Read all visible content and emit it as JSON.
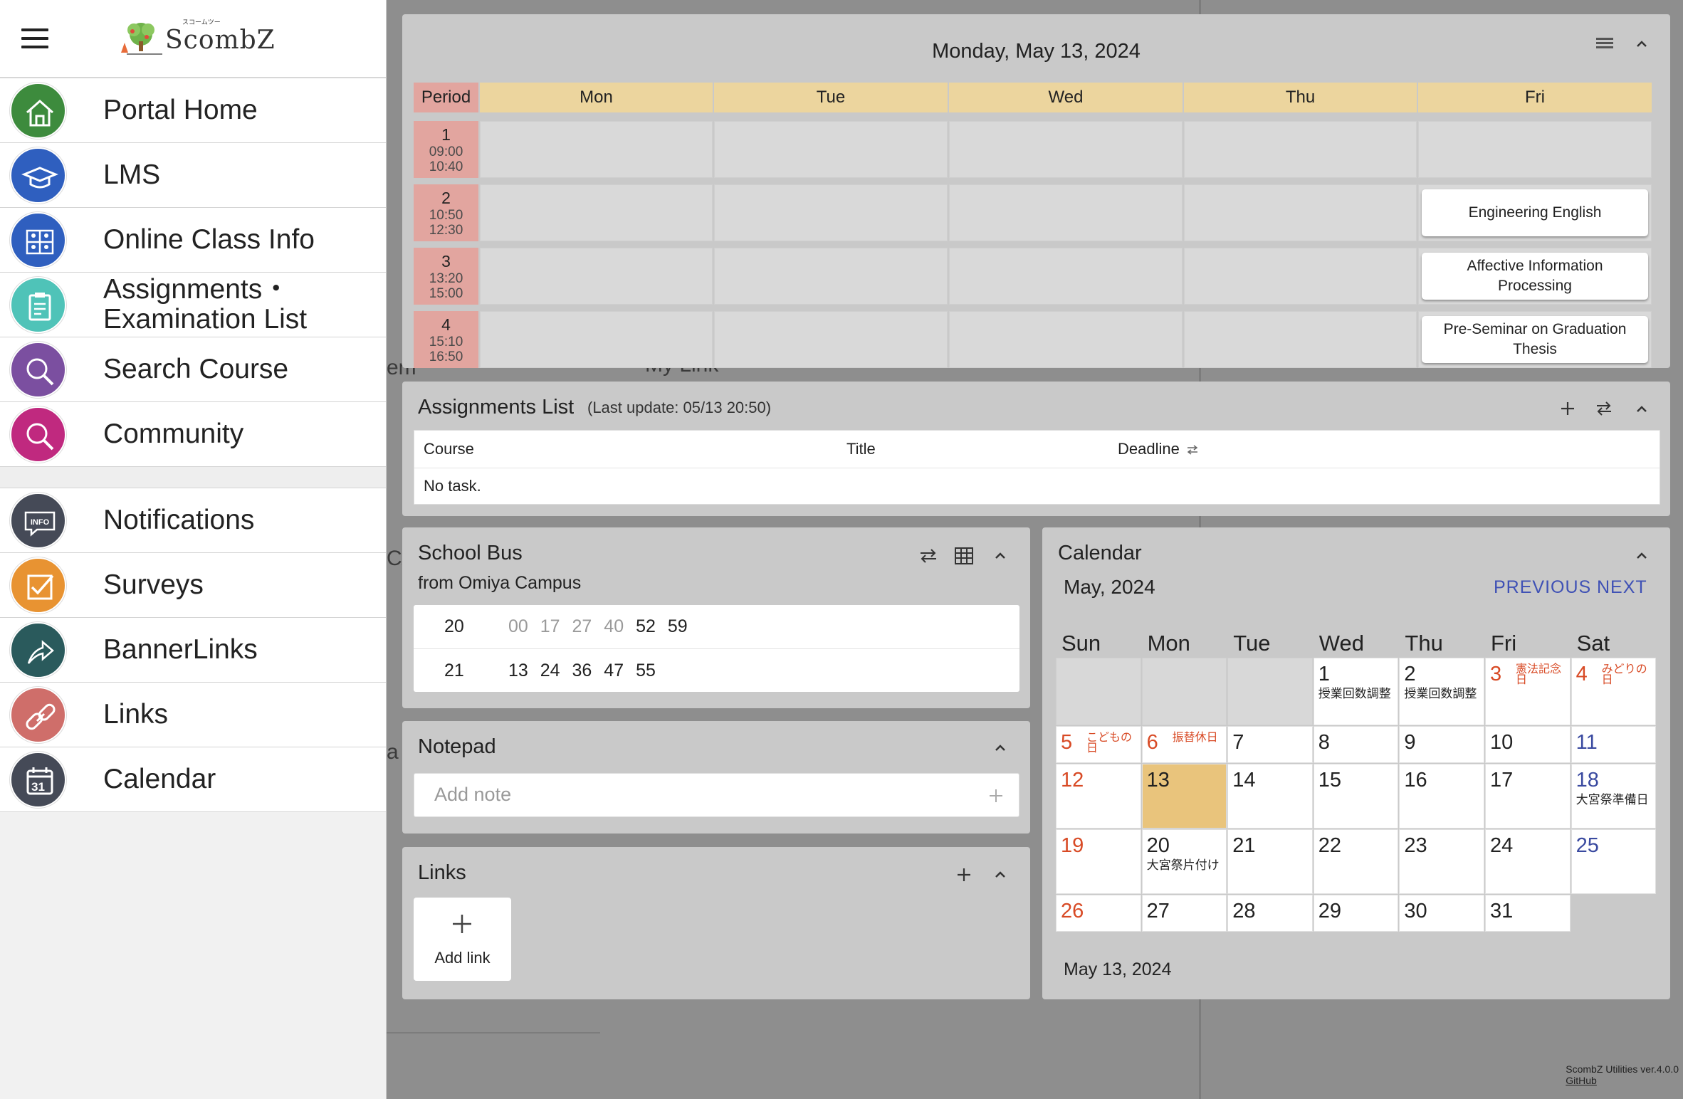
{
  "sidebar": {
    "logo_caption": "スコームツー",
    "logo_text": "ScombZ",
    "items_top": [
      {
        "label": "Portal Home",
        "icon": "house-icon",
        "color": "#3d8b3d"
      },
      {
        "label": "LMS",
        "icon": "graduation-cap-icon",
        "color": "#2f5fbf"
      },
      {
        "label": "Online Class Info",
        "icon": "online-class-icon",
        "color": "#2f5fbf"
      },
      {
        "label": "Assignments・\nExamination List",
        "icon": "clipboard-icon",
        "color": "#4fc3b8"
      },
      {
        "label": "Search Course",
        "icon": "search-icon",
        "color": "#7b4fa0"
      },
      {
        "label": "Community",
        "icon": "search-icon",
        "color": "#c0297f"
      }
    ],
    "items_bottom": [
      {
        "label": "Notifications",
        "icon": "info-bubble-icon",
        "color": "#454a57"
      },
      {
        "label": "Surveys",
        "icon": "checkbox-icon",
        "color": "#e89332"
      },
      {
        "label": "BannerLinks",
        "icon": "arrow-up-icon",
        "color": "#2a5a5c"
      },
      {
        "label": "Links",
        "icon": "link-icon",
        "color": "#cf6e6a"
      },
      {
        "label": "Calendar",
        "icon": "calendar-icon",
        "color": "#454a57",
        "icon_text": "31"
      }
    ]
  },
  "backdrop": {
    "frag_em": "em",
    "frag_mylink": "My Link",
    "frag_ca": "CA",
    "frag_a": "a"
  },
  "timetable": {
    "date": "Monday, May 13, 2024",
    "period_label": "Period",
    "days": [
      "Mon",
      "Tue",
      "Wed",
      "Thu",
      "Fri"
    ],
    "periods": [
      {
        "num": "1",
        "start": "09:00",
        "end": "10:40"
      },
      {
        "num": "2",
        "start": "10:50",
        "end": "12:30"
      },
      {
        "num": "3",
        "start": "13:20",
        "end": "15:00"
      },
      {
        "num": "4",
        "start": "15:10",
        "end": "16:50"
      }
    ],
    "courses": [
      {
        "period": 2,
        "day": 5,
        "name": "Engineering English"
      },
      {
        "period": 3,
        "day": 5,
        "name": "Affective Information Processing"
      },
      {
        "period": 4,
        "day": 5,
        "name": "Pre-Seminar on Graduation Thesis"
      }
    ]
  },
  "assignments": {
    "title": "Assignments List",
    "last_update": "(Last update: 05/13 20:50)",
    "col_course": "Course",
    "col_title": "Title",
    "col_deadline": "Deadline",
    "empty": "No task."
  },
  "bus": {
    "title": "School Bus",
    "subtitle": "from Omiya Campus",
    "rows": [
      {
        "hour": "20",
        "past": [
          "00",
          "17",
          "27",
          "40"
        ],
        "upcoming": [
          "52",
          "59"
        ]
      },
      {
        "hour": "21",
        "past": [],
        "upcoming": [
          "13",
          "24",
          "36",
          "47",
          "55"
        ]
      }
    ]
  },
  "notepad": {
    "title": "Notepad",
    "placeholder": "Add note"
  },
  "links": {
    "title": "Links",
    "add_label": "Add link"
  },
  "calendar": {
    "title": "Calendar",
    "month": "May, 2024",
    "prev": "PREVIOUS",
    "next": "NEXT",
    "weekdays": [
      "Sun",
      "Mon",
      "Tue",
      "Wed",
      "Thu",
      "Fri",
      "Sat"
    ],
    "today": 13,
    "first_weekday": 3,
    "days_in_month": 31,
    "red_days": [
      3,
      4,
      5,
      6,
      12,
      19,
      26
    ],
    "blue_days": [
      11,
      18,
      25
    ],
    "holidays": {
      "3": "憲法記念日",
      "4": "みどりの日",
      "5": "こどもの日",
      "6": "振替休日"
    },
    "notes": {
      "1": "授業回数調整",
      "2": "授業回数調整",
      "18": "大宮祭準備日",
      "20": "大宮祭片付け"
    },
    "footer_date": "May 13, 2024"
  },
  "footer": {
    "version": "ScombZ Utilities ver.4.0.0",
    "github": "GitHub"
  }
}
